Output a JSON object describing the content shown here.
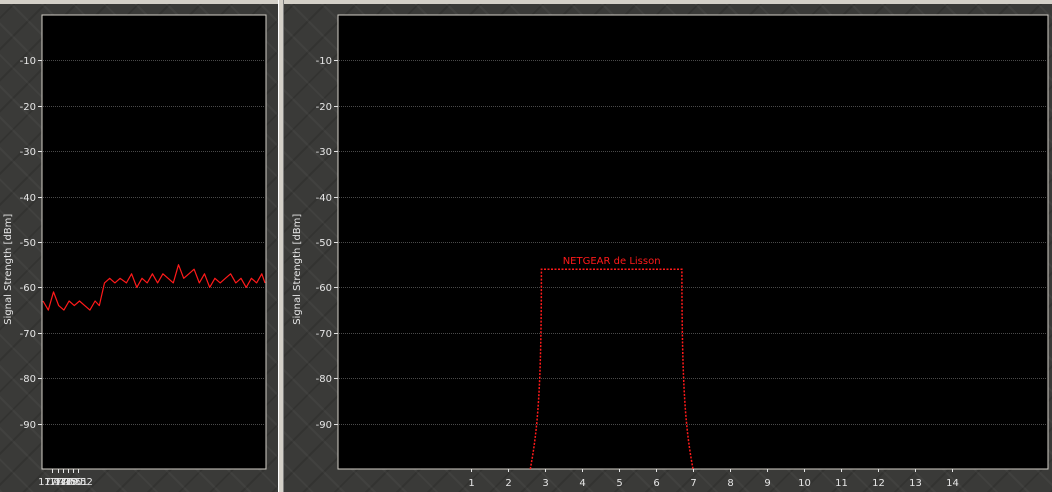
{
  "colors": {
    "plot_background": "#000000",
    "gridline": "#4a4a4a",
    "series": "#ff1a1a",
    "text": "#e6e6e6",
    "frame": "#d4d0c8"
  },
  "chart_data": [
    {
      "type": "line",
      "ylabel": "Signal Strength [dBm]",
      "ylim": [
        -100,
        0
      ],
      "yticks": [
        -10,
        -20,
        -30,
        -40,
        -50,
        -60,
        -70,
        -80,
        -90
      ],
      "xticks": [
        "17:47",
        "17:48",
        "17:49",
        "17:50",
        "17:51",
        "17:52"
      ],
      "xlim_minutes": [
        17.45,
        17.88
      ],
      "grid": true,
      "series": [
        {
          "color": "#ff1a1a",
          "points": [
            [
              17.452,
              -63
            ],
            [
              17.462,
              -65
            ],
            [
              17.472,
              -61
            ],
            [
              17.482,
              -64
            ],
            [
              17.492,
              -65
            ],
            [
              17.502,
              -63
            ],
            [
              17.512,
              -64
            ],
            [
              17.522,
              -63
            ],
            [
              17.532,
              -64
            ],
            [
              17.542,
              -65
            ],
            [
              17.552,
              -63
            ],
            [
              17.56,
              -64
            ],
            [
              17.57,
              -59
            ],
            [
              17.58,
              -58
            ],
            [
              17.59,
              -59
            ],
            [
              17.6,
              -58
            ],
            [
              17.612,
              -59
            ],
            [
              17.622,
              -57
            ],
            [
              17.632,
              -60
            ],
            [
              17.642,
              -58
            ],
            [
              17.652,
              -59
            ],
            [
              17.662,
              -57
            ],
            [
              17.672,
              -59
            ],
            [
              17.682,
              -57
            ],
            [
              17.692,
              -58
            ],
            [
              17.702,
              -59
            ],
            [
              17.712,
              -55
            ],
            [
              17.722,
              -58
            ],
            [
              17.732,
              -57
            ],
            [
              17.742,
              -56
            ],
            [
              17.752,
              -59
            ],
            [
              17.762,
              -57
            ],
            [
              17.772,
              -60
            ],
            [
              17.782,
              -58
            ],
            [
              17.792,
              -59
            ],
            [
              17.802,
              -58
            ],
            [
              17.812,
              -57
            ],
            [
              17.822,
              -59
            ],
            [
              17.832,
              -58
            ],
            [
              17.842,
              -60
            ],
            [
              17.852,
              -58
            ],
            [
              17.862,
              -59
            ],
            [
              17.872,
              -57
            ],
            [
              17.878,
              -59
            ]
          ]
        }
      ]
    },
    {
      "type": "area",
      "ylabel": "Signal Strength [dBm]",
      "ylim": [
        -100,
        0
      ],
      "yticks": [
        -10,
        -20,
        -30,
        -40,
        -50,
        -60,
        -70,
        -80,
        -90
      ],
      "xticks": [
        1,
        2,
        3,
        4,
        5,
        6,
        7,
        8,
        9,
        10,
        11,
        12,
        13,
        14
      ],
      "xlim": [
        -2.6,
        16.6
      ],
      "grid": true,
      "networks": [
        {
          "name": "NETGEAR de Lisson",
          "color": "#ff1a1a",
          "center_channel": 4.8,
          "signal_dbm": -56,
          "floor_dbm": -100
        }
      ]
    }
  ]
}
